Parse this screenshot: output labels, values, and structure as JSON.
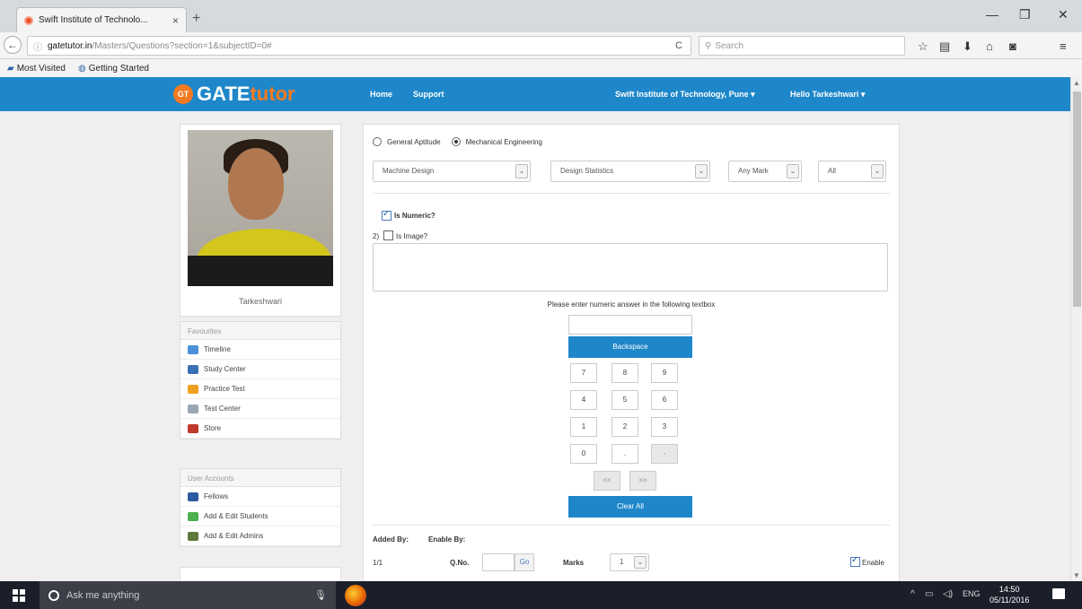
{
  "browser": {
    "tab_title": "Swift Institute of Technolo...",
    "tab_close": "×",
    "new_tab": "+",
    "url_host": "gatetutor.in",
    "url_path": "/Masters/Questions?section=1&subjectID=0#",
    "search_placeholder": "Search",
    "bookmarks": [
      "Most Visited",
      "Getting Started"
    ]
  },
  "site": {
    "logo_badge": "GT",
    "logo_gate": "GATE",
    "logo_tutor": "tutor",
    "nav": {
      "home": "Home",
      "support": "Support",
      "institute": "Swift Institute of Technology, Pune ▾",
      "user": "Hello Tarkeshwari ▾"
    }
  },
  "profile": {
    "name": "Tarkeshwari"
  },
  "favourites": {
    "header": "Favourites",
    "items": [
      {
        "label": "Timeline",
        "color": "#4a90d9"
      },
      {
        "label": "Study Center",
        "color": "#3b6fb6"
      },
      {
        "label": "Practice Test",
        "color": "#f0a020"
      },
      {
        "label": "Test Center",
        "color": "#9aa6b4"
      },
      {
        "label": "Store",
        "color": "#c0392b"
      }
    ]
  },
  "user_accounts": {
    "header": "User Accounts",
    "items": [
      {
        "label": "Fellows",
        "color": "#2c5aa0"
      },
      {
        "label": "Add & Edit Students",
        "color": "#4caf50"
      },
      {
        "label": "Add & Edit Admins",
        "color": "#5d7a3a"
      }
    ]
  },
  "question_form": {
    "radio_general": "General Aptitude",
    "radio_mechanical": "Mechanical Engineering",
    "selected_section": "Mechanical Engineering",
    "subject_select": "Machine Design",
    "topic_select": "Design Statistics",
    "mark_select": "Any Mark",
    "all_select": "All",
    "is_numeric_label": "Is Numeric?",
    "is_numeric_checked": true,
    "question_number": "2)",
    "is_image_label": "Is Image?",
    "is_image_checked": false,
    "numeric_hint": "Please enter numeric answer in the following textbox",
    "backspace": "Backspace",
    "keys": [
      "7",
      "8",
      "9",
      "4",
      "5",
      "6",
      "1",
      "2",
      "3",
      "0",
      ".",
      "-"
    ],
    "left_arrow": "<<",
    "right_arrow": ">>",
    "clear_all": "Clear All",
    "added_by": "Added By:",
    "enable_by": "Enable By:",
    "page_count": "1/1",
    "q_no_label": "Q.No.",
    "go": "Go",
    "marks_label": "Marks",
    "marks_value": "1",
    "enable_label": "Enable",
    "enable_checked": true
  },
  "taskbar": {
    "search_placeholder": "Ask me anything",
    "language": "ENG",
    "time": "14:50",
    "date": "05/11/2016"
  },
  "colors": {
    "header_blue": "#1e87c9",
    "logo_orange": "#f47a20"
  }
}
